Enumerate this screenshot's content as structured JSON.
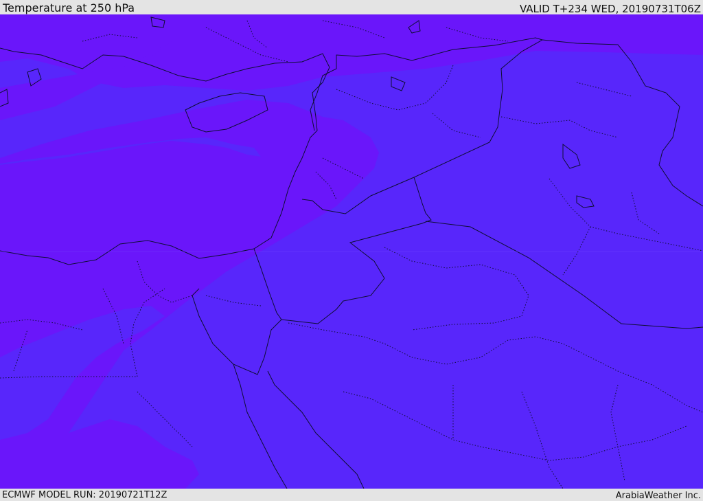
{
  "header": {
    "title": "Temperature at 250 hPa",
    "valid_time": "VALID T+234 WED, 20190731T06Z"
  },
  "footer": {
    "model_run": "ECMWF MODEL RUN: 20190721T12Z",
    "credit": "ArabiaWeather Inc."
  },
  "map": {
    "colors": {
      "cold_band": "#6a16fa",
      "warm_field": "#5826fb",
      "boundary_line": "#0e0e33"
    }
  }
}
